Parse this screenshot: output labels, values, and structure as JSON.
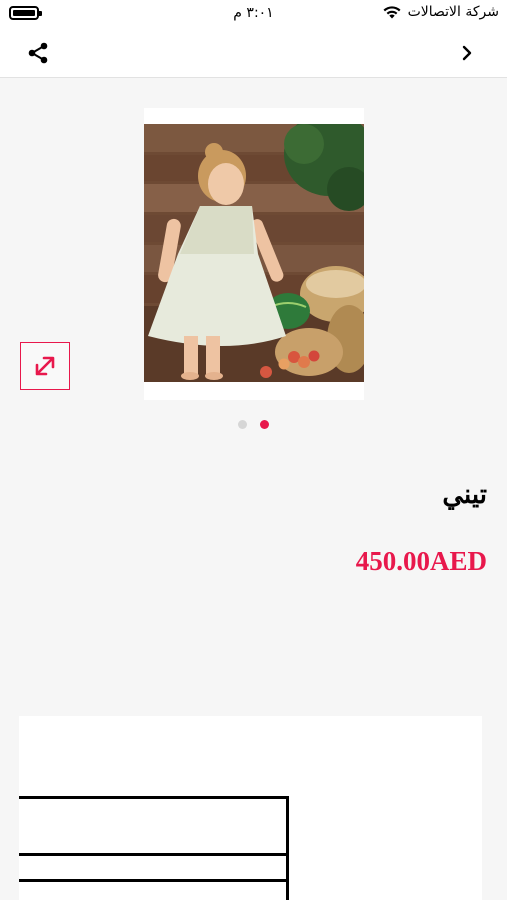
{
  "status_bar": {
    "carrier": "شركة الاتصالات",
    "time": "٣:٠١ م"
  },
  "nav": {
    "share_icon": "share-icon",
    "back_icon": "chevron-right-icon"
  },
  "product": {
    "name": "تيني",
    "price": "450.00AED",
    "image_page": 2,
    "image_count": 2
  },
  "colors": {
    "accent": "#e8184c",
    "background": "#f6f6f6"
  }
}
